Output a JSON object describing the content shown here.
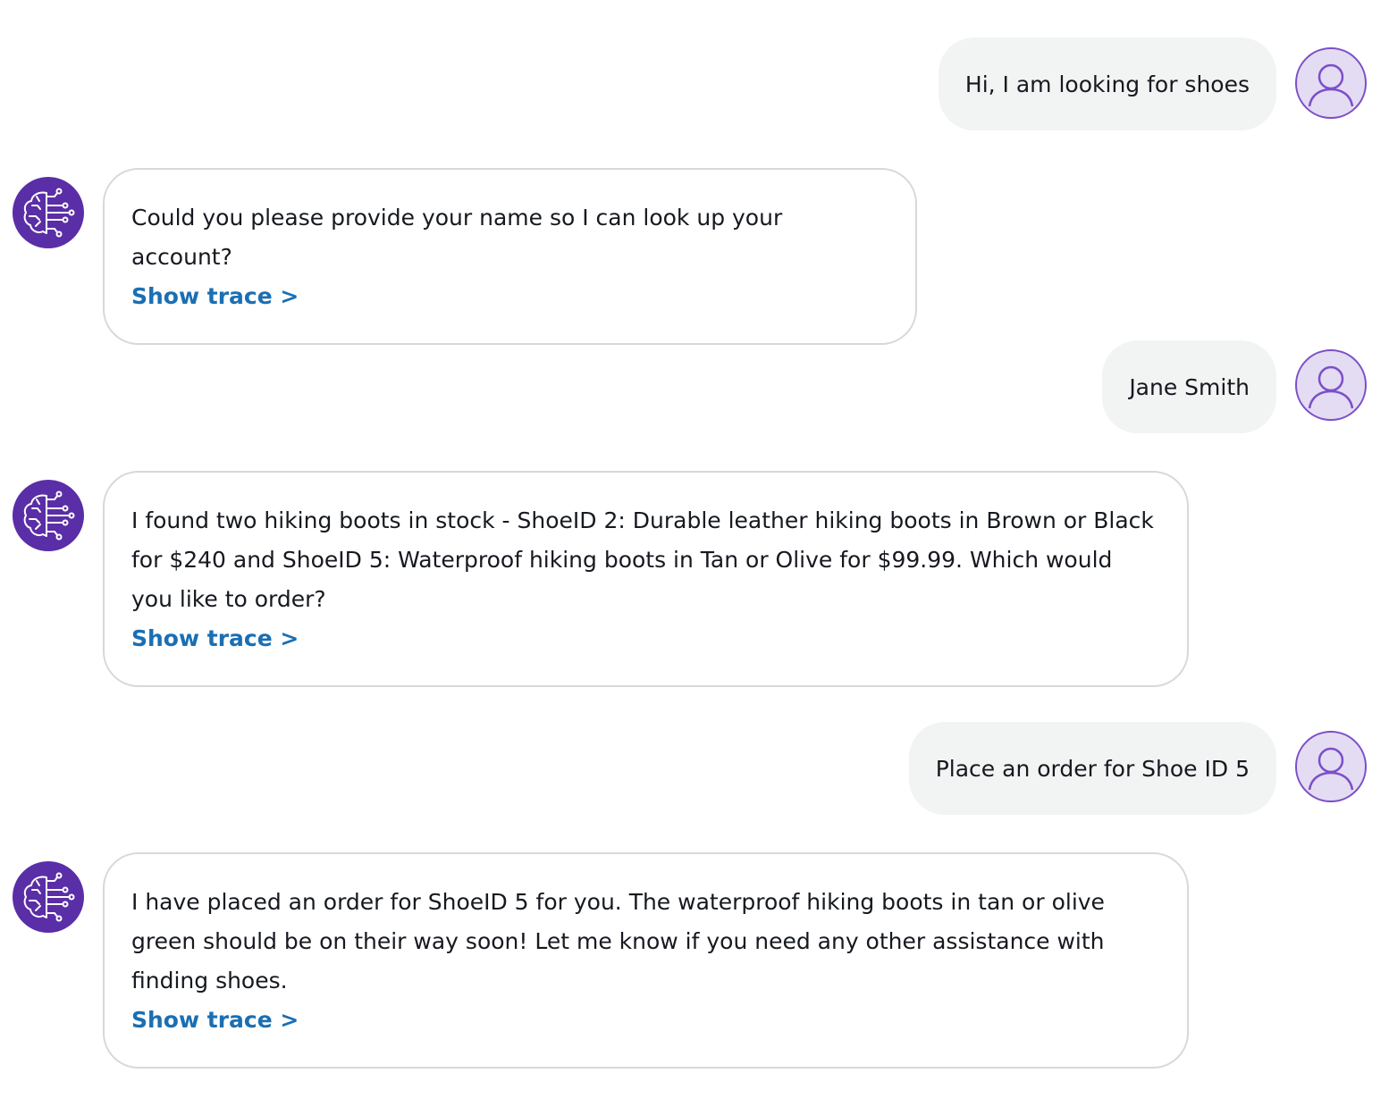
{
  "messages": [
    {
      "role": "user",
      "text": "Hi, I am looking for shoes"
    },
    {
      "role": "assistant",
      "text": "Could you please provide your name so I can look up your account?",
      "trace_label": "Show trace >"
    },
    {
      "role": "user",
      "text": "Jane Smith"
    },
    {
      "role": "assistant",
      "text": "I found two hiking boots in stock - ShoeID 2: Durable leather hiking boots in Brown or Black for $240 and ShoeID 5: Waterproof hiking boots in Tan or Olive for $99.99. Which would you like to order?",
      "trace_label": "Show trace >"
    },
    {
      "role": "user",
      "text": "Place an order for Shoe ID 5"
    },
    {
      "role": "assistant",
      "text": "I have placed an order for ShoeID 5 for you. The waterproof hiking boots in tan or olive green should be on their way soon! Let me know if you need any other assistance with finding shoes.",
      "trace_label": "Show trace >"
    }
  ],
  "icons": {
    "user_avatar": "user-profile-icon",
    "bot_avatar": "ai-brain-circuit-icon"
  },
  "colors": {
    "link": "#1a6fb3",
    "bot_avatar_bg": "#5a2ea6",
    "user_avatar_bg": "#e4dcf3",
    "user_bubble_bg": "#f2f3f3"
  }
}
